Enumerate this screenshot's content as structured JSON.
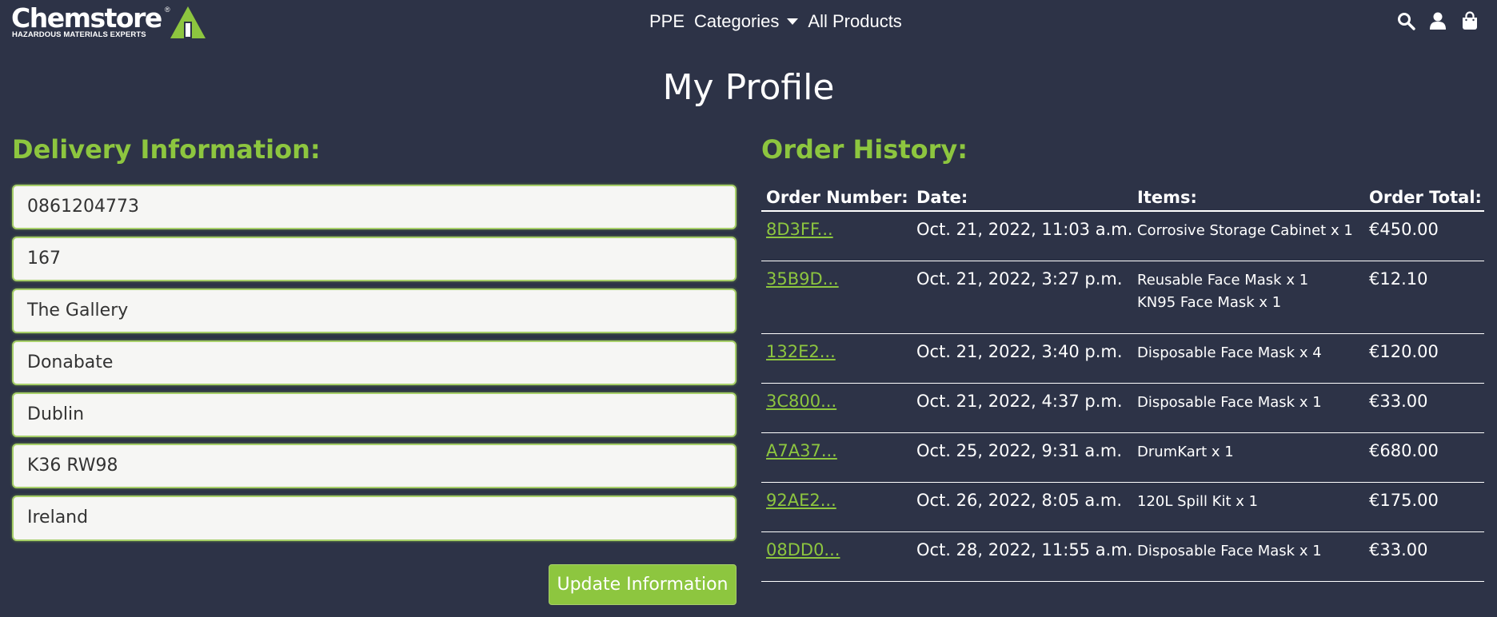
{
  "nav": {
    "logo_text": "Chemstore",
    "logo_registered": "®",
    "logo_tagline": "HAZARDOUS MATERIALS EXPERTS",
    "links": [
      "PPE",
      "Categories",
      "All Products"
    ],
    "icons": [
      "search-icon",
      "user-icon",
      "shopping-bag-icon"
    ]
  },
  "page": {
    "title": "My Profile"
  },
  "delivery": {
    "title": "Delivery Information:",
    "fields": [
      "0861204773",
      "167",
      "The Gallery",
      "Donabate",
      "Dublin",
      "K36 RW98",
      "Ireland"
    ],
    "update_label": "Update Information"
  },
  "history": {
    "title": "Order History:",
    "columns": [
      "Order Number:",
      "Date:",
      "Items:",
      "Order Total:"
    ],
    "orders": [
      {
        "number": "8D3FF...",
        "date": "Oct. 21, 2022, 11:03 a.m.",
        "items": [
          "Corrosive Storage Cabinet x 1"
        ],
        "total": "€450.00"
      },
      {
        "number": "35B9D...",
        "date": "Oct. 21, 2022, 3:27 p.m.",
        "items": [
          "Reusable Face Mask x 1",
          "KN95 Face Mask x 1"
        ],
        "total": "€12.10"
      },
      {
        "number": "132E2...",
        "date": "Oct. 21, 2022, 3:40 p.m.",
        "items": [
          "Disposable Face Mask x 4"
        ],
        "total": "€120.00"
      },
      {
        "number": "3C800...",
        "date": "Oct. 21, 2022, 4:37 p.m.",
        "items": [
          "Disposable Face Mask x 1"
        ],
        "total": "€33.00"
      },
      {
        "number": "A7A37...",
        "date": "Oct. 25, 2022, 9:31 a.m.",
        "items": [
          "DrumKart x 1"
        ],
        "total": "€680.00"
      },
      {
        "number": "92AE2...",
        "date": "Oct. 26, 2022, 8:05 a.m.",
        "items": [
          "120L Spill Kit x 1"
        ],
        "total": "€175.00"
      },
      {
        "number": "08DD0...",
        "date": "Oct. 28, 2022, 11:55 a.m.",
        "items": [
          "Disposable Face Mask x 1"
        ],
        "total": "€33.00"
      }
    ]
  },
  "colors": {
    "background": "#2d3347",
    "accent": "#8dc63f",
    "text": "#ffffff"
  }
}
